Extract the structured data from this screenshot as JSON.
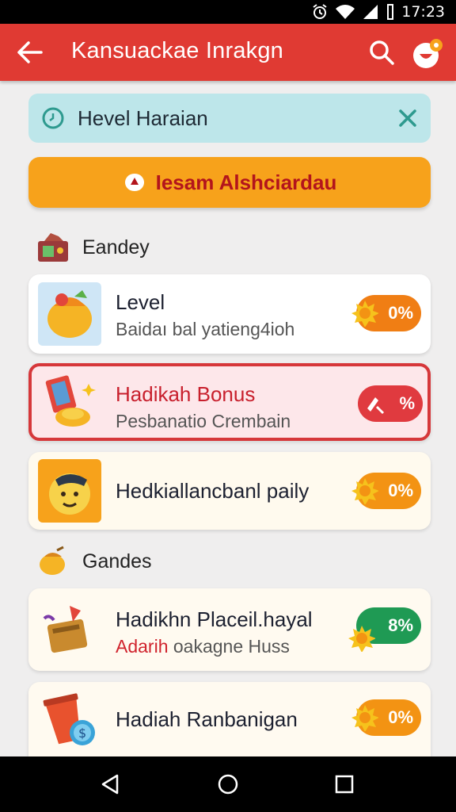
{
  "status_bar": {
    "time": "17:23"
  },
  "app_bar": {
    "title": "Kansuackae Inrakgn"
  },
  "level_bar": {
    "label": "Hevel Haraian"
  },
  "cta": {
    "label": "Iesam Alshciardau"
  },
  "sections": [
    {
      "label": "Eandey"
    },
    {
      "label": "Gandes"
    }
  ],
  "cards": [
    {
      "title": "Level",
      "subtitle": "Baidaı bal yatieng4ioh",
      "badge": "0%",
      "badge_color": "#f07e14"
    },
    {
      "title": "Hadikah Bonus",
      "subtitle": "Pesbanatio Crembain",
      "badge": "%",
      "badge_color": "#e03a3f",
      "selected": true
    },
    {
      "title": "Hedkiallancbanl paily",
      "subtitle": "",
      "badge": "0%",
      "badge_color": "#f39313"
    },
    {
      "title": "Hadikhn Placeil.hayal",
      "subtitle_highlight": "Adarih",
      "subtitle": "oakagne Huss",
      "badge": "8%",
      "badge_color": "#1f9a54"
    },
    {
      "title": "Hadiah Ranbanigan",
      "subtitle": "",
      "badge": "0%",
      "badge_color": "#f39313"
    }
  ],
  "colors": {
    "app_bar": "#e03a33",
    "cta": "#f7a21b",
    "level_bar": "#bde6ea",
    "selected_border": "#d6373a",
    "selected_bg": "#fde7ea"
  },
  "icons": [
    "alarm-icon",
    "wifi-icon",
    "vibrate-icon",
    "signal-icon",
    "battery-icon",
    "back-arrow-icon",
    "search-icon",
    "profile-badge-icon",
    "timer-icon",
    "close-icon",
    "tag-icon",
    "shop-icon",
    "bag-icon",
    "cards-coin-icon",
    "emoji-face-icon",
    "nut-icon",
    "treasure-box-icon",
    "cup-coin-icon",
    "sun-badge-icon",
    "nav-back-icon",
    "nav-home-icon",
    "nav-recents-icon"
  ]
}
